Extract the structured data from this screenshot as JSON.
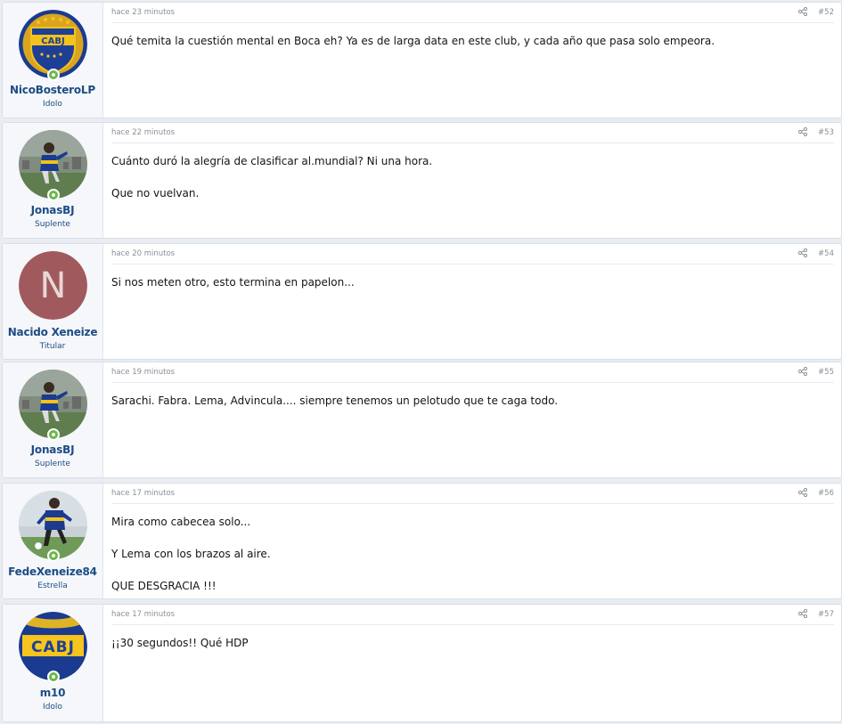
{
  "posts": [
    {
      "username": "NicoBosteroLP",
      "user_title": "Idolo",
      "avatar": "boca-crest-avatar",
      "time": "hace 23 minutos",
      "post_number": "#52",
      "paragraphs": [
        "Qué temita la cuestión mental en Boca eh? Ya es de larga data en este club, y cada año que pasa solo empeora."
      ]
    },
    {
      "username": "JonasBJ",
      "user_title": "Suplente",
      "avatar": "player-photo-avatar",
      "time": "hace 22 minutos",
      "post_number": "#53",
      "paragraphs": [
        "Cuánto duró la alegría de clasificar al.mundial? Ni una hora.",
        "Que no vuelvan."
      ]
    },
    {
      "username": "Nacido Xeneize",
      "user_title": "Titular",
      "avatar": "letter-avatar",
      "avatar_letter": "N",
      "time": "hace 20 minutos",
      "post_number": "#54",
      "paragraphs": [
        "Si nos meten otro, esto termina en papelon..."
      ]
    },
    {
      "username": "JonasBJ",
      "user_title": "Suplente",
      "avatar": "player-photo-avatar",
      "time": "hace 19 minutos",
      "post_number": "#55",
      "paragraphs": [
        "Sarachi. Fabra. Lema, Advincula.... siempre tenemos un pelotudo que te caga todo."
      ]
    },
    {
      "username": "FedeXeneize84",
      "user_title": "Estrella",
      "avatar": "player-photo-avatar",
      "time": "hace 17 minutos",
      "post_number": "#56",
      "paragraphs": [
        "Mira como cabecea solo...",
        "Y Lema con los brazos al aire.",
        "QUE DESGRACIA !!!"
      ]
    },
    {
      "username": "m10",
      "user_title": "Idolo",
      "avatar": "boca-crest-avatar",
      "time": "hace 17 minutos",
      "post_number": "#57",
      "paragraphs": [
        "¡¡30 segundos!! Qué HDP"
      ]
    }
  ],
  "crest_text": "CABJ",
  "colors": {
    "link": "#1d4c85",
    "meta": "#8a8f96",
    "boca_blue": "#1a3b8f",
    "boca_gold": "#f4c21b",
    "online": "#6cb74b",
    "letter_avatar_bg": "#a05a5e"
  }
}
